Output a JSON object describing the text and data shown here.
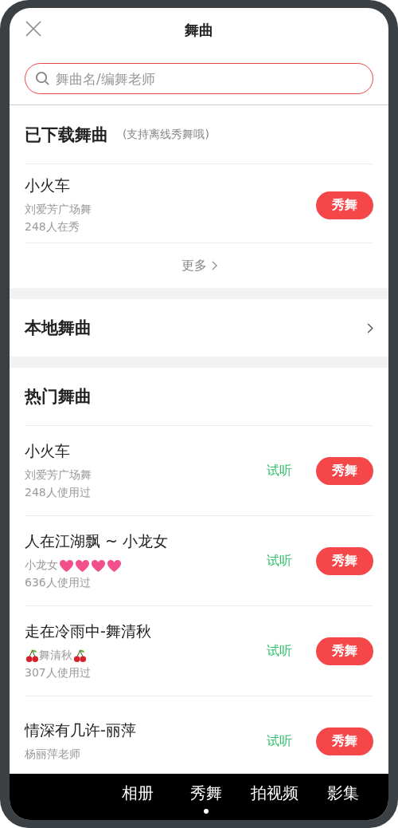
{
  "header": {
    "title": "舞曲"
  },
  "search": {
    "placeholder": "舞曲名/编舞老师"
  },
  "downloaded": {
    "title": "已下载舞曲",
    "note": "(支持离线秀舞哦)",
    "items": [
      {
        "name": "小火车",
        "artist": "刘爱芳广场舞",
        "count": "248人在秀",
        "button": "秀舞"
      }
    ],
    "more": "更多"
  },
  "local": {
    "title": "本地舞曲"
  },
  "hot": {
    "title": "热门舞曲",
    "items": [
      {
        "name": "小火车",
        "artist": "刘爱芳广场舞",
        "kind": "plain",
        "count": "248人使用过",
        "preview": "试听",
        "button": "秀舞"
      },
      {
        "name": "人在江湖飘 ~ 小龙女",
        "artist": "小龙女",
        "kind": "hearts",
        "count": "636人使用过",
        "preview": "试听",
        "button": "秀舞"
      },
      {
        "name": "走在冷雨中-舞清秋",
        "artist": "舞清秋",
        "kind": "cherries",
        "count": "307人使用过",
        "preview": "试听",
        "button": "秀舞"
      },
      {
        "name": "情深有几许-丽萍",
        "artist": "杨丽萍老师",
        "kind": "plain",
        "preview": "试听",
        "button": "秀舞"
      }
    ]
  },
  "nav": [
    {
      "label": "相册",
      "selected": false
    },
    {
      "label": "秀舞",
      "selected": true
    },
    {
      "label": "拍视频",
      "selected": false
    },
    {
      "label": "影集",
      "selected": false
    }
  ]
}
